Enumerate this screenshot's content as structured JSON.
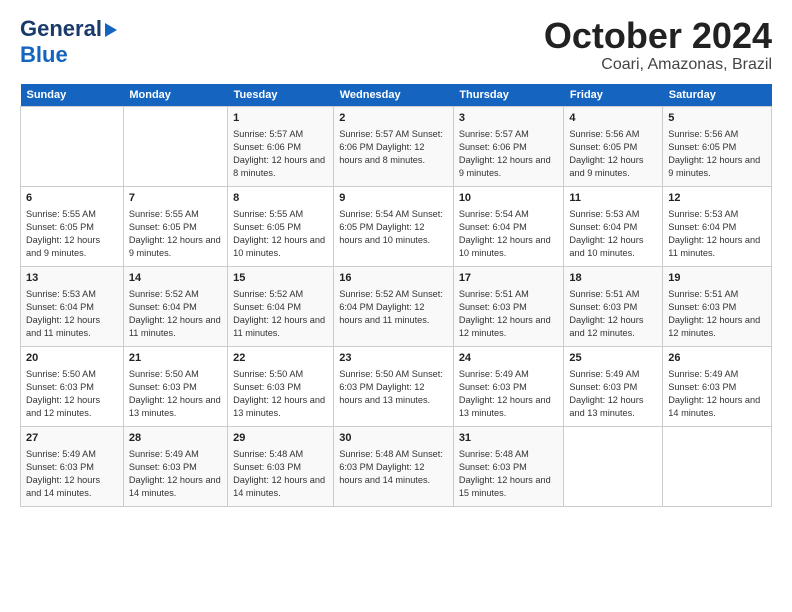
{
  "logo": {
    "line1": "General",
    "line2": "Blue"
  },
  "title": "October 2024",
  "subtitle": "Coari, Amazonas, Brazil",
  "days_of_week": [
    "Sunday",
    "Monday",
    "Tuesday",
    "Wednesday",
    "Thursday",
    "Friday",
    "Saturday"
  ],
  "weeks": [
    [
      {
        "day": "",
        "content": ""
      },
      {
        "day": "",
        "content": ""
      },
      {
        "day": "1",
        "content": "Sunrise: 5:57 AM\nSunset: 6:06 PM\nDaylight: 12 hours\nand 8 minutes."
      },
      {
        "day": "2",
        "content": "Sunrise: 5:57 AM\nSunset: 6:06 PM\nDaylight: 12 hours\nand 8 minutes."
      },
      {
        "day": "3",
        "content": "Sunrise: 5:57 AM\nSunset: 6:06 PM\nDaylight: 12 hours\nand 9 minutes."
      },
      {
        "day": "4",
        "content": "Sunrise: 5:56 AM\nSunset: 6:05 PM\nDaylight: 12 hours\nand 9 minutes."
      },
      {
        "day": "5",
        "content": "Sunrise: 5:56 AM\nSunset: 6:05 PM\nDaylight: 12 hours\nand 9 minutes."
      }
    ],
    [
      {
        "day": "6",
        "content": "Sunrise: 5:55 AM\nSunset: 6:05 PM\nDaylight: 12 hours\nand 9 minutes."
      },
      {
        "day": "7",
        "content": "Sunrise: 5:55 AM\nSunset: 6:05 PM\nDaylight: 12 hours\nand 9 minutes."
      },
      {
        "day": "8",
        "content": "Sunrise: 5:55 AM\nSunset: 6:05 PM\nDaylight: 12 hours\nand 10 minutes."
      },
      {
        "day": "9",
        "content": "Sunrise: 5:54 AM\nSunset: 6:05 PM\nDaylight: 12 hours\nand 10 minutes."
      },
      {
        "day": "10",
        "content": "Sunrise: 5:54 AM\nSunset: 6:04 PM\nDaylight: 12 hours\nand 10 minutes."
      },
      {
        "day": "11",
        "content": "Sunrise: 5:53 AM\nSunset: 6:04 PM\nDaylight: 12 hours\nand 10 minutes."
      },
      {
        "day": "12",
        "content": "Sunrise: 5:53 AM\nSunset: 6:04 PM\nDaylight: 12 hours\nand 11 minutes."
      }
    ],
    [
      {
        "day": "13",
        "content": "Sunrise: 5:53 AM\nSunset: 6:04 PM\nDaylight: 12 hours\nand 11 minutes."
      },
      {
        "day": "14",
        "content": "Sunrise: 5:52 AM\nSunset: 6:04 PM\nDaylight: 12 hours\nand 11 minutes."
      },
      {
        "day": "15",
        "content": "Sunrise: 5:52 AM\nSunset: 6:04 PM\nDaylight: 12 hours\nand 11 minutes."
      },
      {
        "day": "16",
        "content": "Sunrise: 5:52 AM\nSunset: 6:04 PM\nDaylight: 12 hours\nand 11 minutes."
      },
      {
        "day": "17",
        "content": "Sunrise: 5:51 AM\nSunset: 6:03 PM\nDaylight: 12 hours\nand 12 minutes."
      },
      {
        "day": "18",
        "content": "Sunrise: 5:51 AM\nSunset: 6:03 PM\nDaylight: 12 hours\nand 12 minutes."
      },
      {
        "day": "19",
        "content": "Sunrise: 5:51 AM\nSunset: 6:03 PM\nDaylight: 12 hours\nand 12 minutes."
      }
    ],
    [
      {
        "day": "20",
        "content": "Sunrise: 5:50 AM\nSunset: 6:03 PM\nDaylight: 12 hours\nand 12 minutes."
      },
      {
        "day": "21",
        "content": "Sunrise: 5:50 AM\nSunset: 6:03 PM\nDaylight: 12 hours\nand 13 minutes."
      },
      {
        "day": "22",
        "content": "Sunrise: 5:50 AM\nSunset: 6:03 PM\nDaylight: 12 hours\nand 13 minutes."
      },
      {
        "day": "23",
        "content": "Sunrise: 5:50 AM\nSunset: 6:03 PM\nDaylight: 12 hours\nand 13 minutes."
      },
      {
        "day": "24",
        "content": "Sunrise: 5:49 AM\nSunset: 6:03 PM\nDaylight: 12 hours\nand 13 minutes."
      },
      {
        "day": "25",
        "content": "Sunrise: 5:49 AM\nSunset: 6:03 PM\nDaylight: 12 hours\nand 13 minutes."
      },
      {
        "day": "26",
        "content": "Sunrise: 5:49 AM\nSunset: 6:03 PM\nDaylight: 12 hours\nand 14 minutes."
      }
    ],
    [
      {
        "day": "27",
        "content": "Sunrise: 5:49 AM\nSunset: 6:03 PM\nDaylight: 12 hours\nand 14 minutes."
      },
      {
        "day": "28",
        "content": "Sunrise: 5:49 AM\nSunset: 6:03 PM\nDaylight: 12 hours\nand 14 minutes."
      },
      {
        "day": "29",
        "content": "Sunrise: 5:48 AM\nSunset: 6:03 PM\nDaylight: 12 hours\nand 14 minutes."
      },
      {
        "day": "30",
        "content": "Sunrise: 5:48 AM\nSunset: 6:03 PM\nDaylight: 12 hours\nand 14 minutes."
      },
      {
        "day": "31",
        "content": "Sunrise: 5:48 AM\nSunset: 6:03 PM\nDaylight: 12 hours\nand 15 minutes."
      },
      {
        "day": "",
        "content": ""
      },
      {
        "day": "",
        "content": ""
      }
    ]
  ]
}
